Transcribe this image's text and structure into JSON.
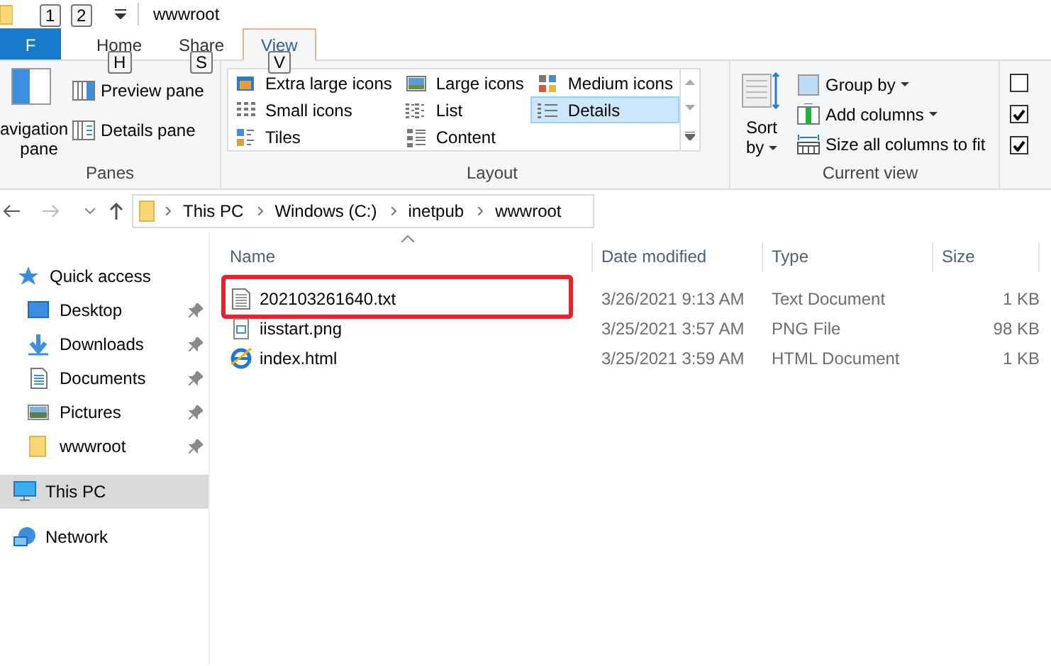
{
  "title_bar": {
    "key_tips": [
      "1",
      "2"
    ],
    "title": "wwwroot"
  },
  "ribbon_tabs": [
    {
      "label": "F",
      "kind": "file",
      "selected": false
    },
    {
      "label": "Home",
      "key_tip": "H",
      "kind": "tab",
      "selected": false
    },
    {
      "label": "Share",
      "key_tip": "S",
      "kind": "tab",
      "selected": false
    },
    {
      "label": "View",
      "key_tip": "V",
      "kind": "tab",
      "selected": true
    }
  ],
  "panes": {
    "label": "Panes",
    "navigation_pane": [
      "avigation",
      "pane"
    ],
    "buttons": [
      {
        "label": "Preview pane",
        "kind": "preview"
      },
      {
        "label": "Details pane",
        "kind": "details"
      }
    ]
  },
  "layout": {
    "label": "Layout",
    "options": [
      {
        "label": "Extra large icons",
        "kind": "xl",
        "selected": false
      },
      {
        "label": "Large icons",
        "kind": "large",
        "selected": false
      },
      {
        "label": "Medium icons",
        "kind": "medium",
        "selected": false
      },
      {
        "label": "Small icons",
        "kind": "small",
        "selected": false
      },
      {
        "label": "List",
        "kind": "list",
        "selected": false
      },
      {
        "label": "Details",
        "kind": "details",
        "selected": true
      },
      {
        "label": "Tiles",
        "kind": "tiles",
        "selected": false
      },
      {
        "label": "Content",
        "kind": "content",
        "selected": false
      }
    ]
  },
  "current_view": {
    "label": "Current view",
    "sort_by": [
      "Sort",
      "by"
    ],
    "buttons": [
      {
        "label": "Group by",
        "kind": "group",
        "dropdown": true
      },
      {
        "label": "Add columns",
        "kind": "columns",
        "dropdown": true
      },
      {
        "label": "Size all columns to fit",
        "kind": "fit",
        "dropdown": false
      }
    ]
  },
  "show_hide": [
    {
      "checked": false
    },
    {
      "checked": true
    },
    {
      "checked": true
    }
  ],
  "address_bar": {
    "path": [
      "This PC",
      "Windows (C:)",
      "inetpub",
      "wwwroot"
    ]
  },
  "navigation": [
    {
      "label": "Quick access",
      "kind": "star",
      "selected": false,
      "children": [
        {
          "label": "Desktop",
          "kind": "desktop",
          "pinned": true,
          "selected": false
        },
        {
          "label": "Downloads",
          "kind": "downloads",
          "pinned": true,
          "selected": false
        },
        {
          "label": "Documents",
          "kind": "documents",
          "pinned": true,
          "selected": false
        },
        {
          "label": "Pictures",
          "kind": "pictures",
          "pinned": true,
          "selected": false
        },
        {
          "label": "wwwroot",
          "kind": "folder",
          "pinned": true,
          "selected": false
        }
      ]
    },
    {
      "label": "This PC",
      "kind": "pc",
      "selected": true
    },
    {
      "label": "Network",
      "kind": "network",
      "selected": false
    }
  ],
  "files": {
    "columns": [
      {
        "label": "Name",
        "sorted": true
      },
      {
        "label": "Date modified",
        "sorted": false
      },
      {
        "label": "Type",
        "sorted": false
      },
      {
        "label": "Size",
        "sorted": false
      }
    ],
    "rows": [
      {
        "name": "202103261640.txt",
        "kind": "text",
        "date_modified": "3/26/2021 9:13 AM",
        "type": "Text Document",
        "size": "1 KB",
        "highlighted": true
      },
      {
        "name": "iisstart.png",
        "kind": "image",
        "date_modified": "3/25/2021 3:57 AM",
        "type": "PNG File",
        "size": "98 KB",
        "highlighted": false
      },
      {
        "name": "index.html",
        "kind": "html",
        "date_modified": "3/25/2021 3:59 AM",
        "type": "HTML Document",
        "size": "1 KB",
        "highlighted": false
      }
    ]
  }
}
